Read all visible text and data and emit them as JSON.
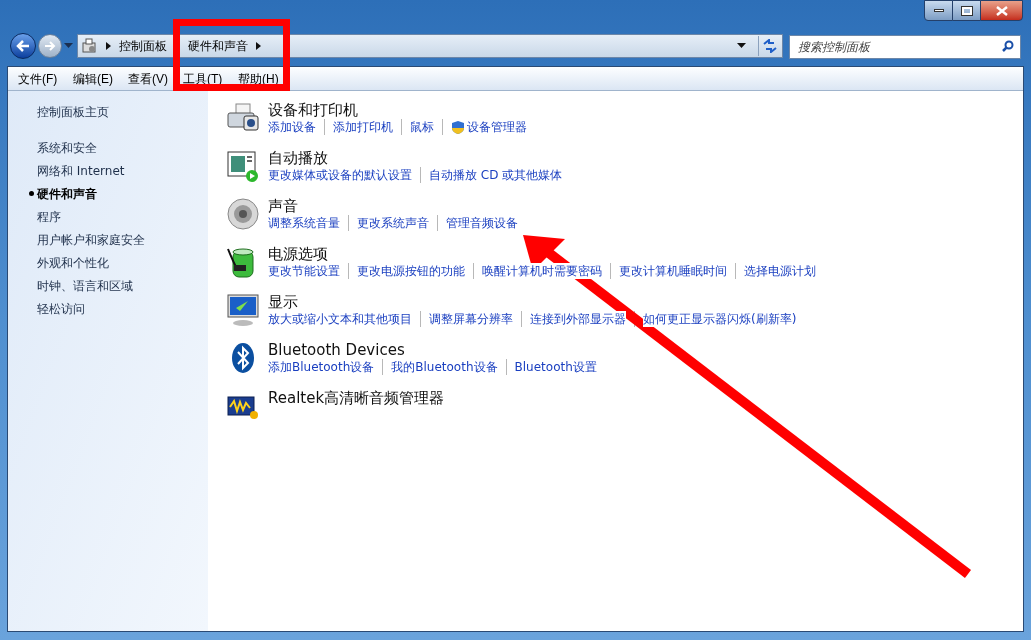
{
  "address_bar": {
    "crumbs": [
      "控制面板",
      "硬件和声音"
    ]
  },
  "search": {
    "placeholder": "搜索控制面板"
  },
  "menu": [
    "文件(F)",
    "编辑(E)",
    "查看(V)",
    "工具(T)",
    "帮助(H)"
  ],
  "sidebar": {
    "home": "控制面板主页",
    "items": [
      {
        "label": "系统和安全",
        "selected": false
      },
      {
        "label": "网络和 Internet",
        "selected": false
      },
      {
        "label": "硬件和声音",
        "selected": true
      },
      {
        "label": "程序",
        "selected": false
      },
      {
        "label": "用户帐户和家庭安全",
        "selected": false
      },
      {
        "label": "外观和个性化",
        "selected": false
      },
      {
        "label": "时钟、语言和区域",
        "selected": false
      },
      {
        "label": "轻松访问",
        "selected": false
      }
    ]
  },
  "sections": [
    {
      "kind": "printer",
      "title": "设备和打印机",
      "links": [
        {
          "label": "添加设备",
          "kind": "plain"
        },
        {
          "label": "添加打印机",
          "kind": "plain"
        },
        {
          "label": "鼠标",
          "kind": "plain"
        },
        {
          "label": "设备管理器",
          "kind": "admin"
        }
      ]
    },
    {
      "kind": "autoplay",
      "title": "自动播放",
      "links": [
        {
          "label": "更改媒体或设备的默认设置",
          "kind": "plain"
        },
        {
          "label": "自动播放 CD 或其他媒体",
          "kind": "plain"
        }
      ]
    },
    {
      "kind": "sound",
      "title": "声音",
      "links": [
        {
          "label": "调整系统音量",
          "kind": "plain"
        },
        {
          "label": "更改系统声音",
          "kind": "plain"
        },
        {
          "label": "管理音频设备",
          "kind": "plain"
        }
      ]
    },
    {
      "kind": "power",
      "title": "电源选项",
      "links": [
        {
          "label": "更改节能设置",
          "kind": "plain"
        },
        {
          "label": "更改电源按钮的功能",
          "kind": "plain"
        },
        {
          "label": "唤醒计算机时需要密码",
          "kind": "plain"
        },
        {
          "label": "更改计算机睡眠时间",
          "kind": "plain"
        },
        {
          "label": "选择电源计划",
          "kind": "plain"
        }
      ]
    },
    {
      "kind": "display",
      "title": "显示",
      "links": [
        {
          "label": "放大或缩小文本和其他项目",
          "kind": "plain"
        },
        {
          "label": "调整屏幕分辨率",
          "kind": "plain"
        },
        {
          "label": "连接到外部显示器",
          "kind": "plain"
        },
        {
          "label": "如何更正显示器闪烁(刷新率)",
          "kind": "plain"
        }
      ]
    },
    {
      "kind": "bluetooth",
      "title": "Bluetooth Devices",
      "links": [
        {
          "label": "添加Bluetooth设备",
          "kind": "plain"
        },
        {
          "label": "我的Bluetooth设备",
          "kind": "plain"
        },
        {
          "label": "Bluetooth设置",
          "kind": "plain"
        }
      ]
    },
    {
      "kind": "audio",
      "title": "Realtek高清晰音频管理器"
    }
  ]
}
